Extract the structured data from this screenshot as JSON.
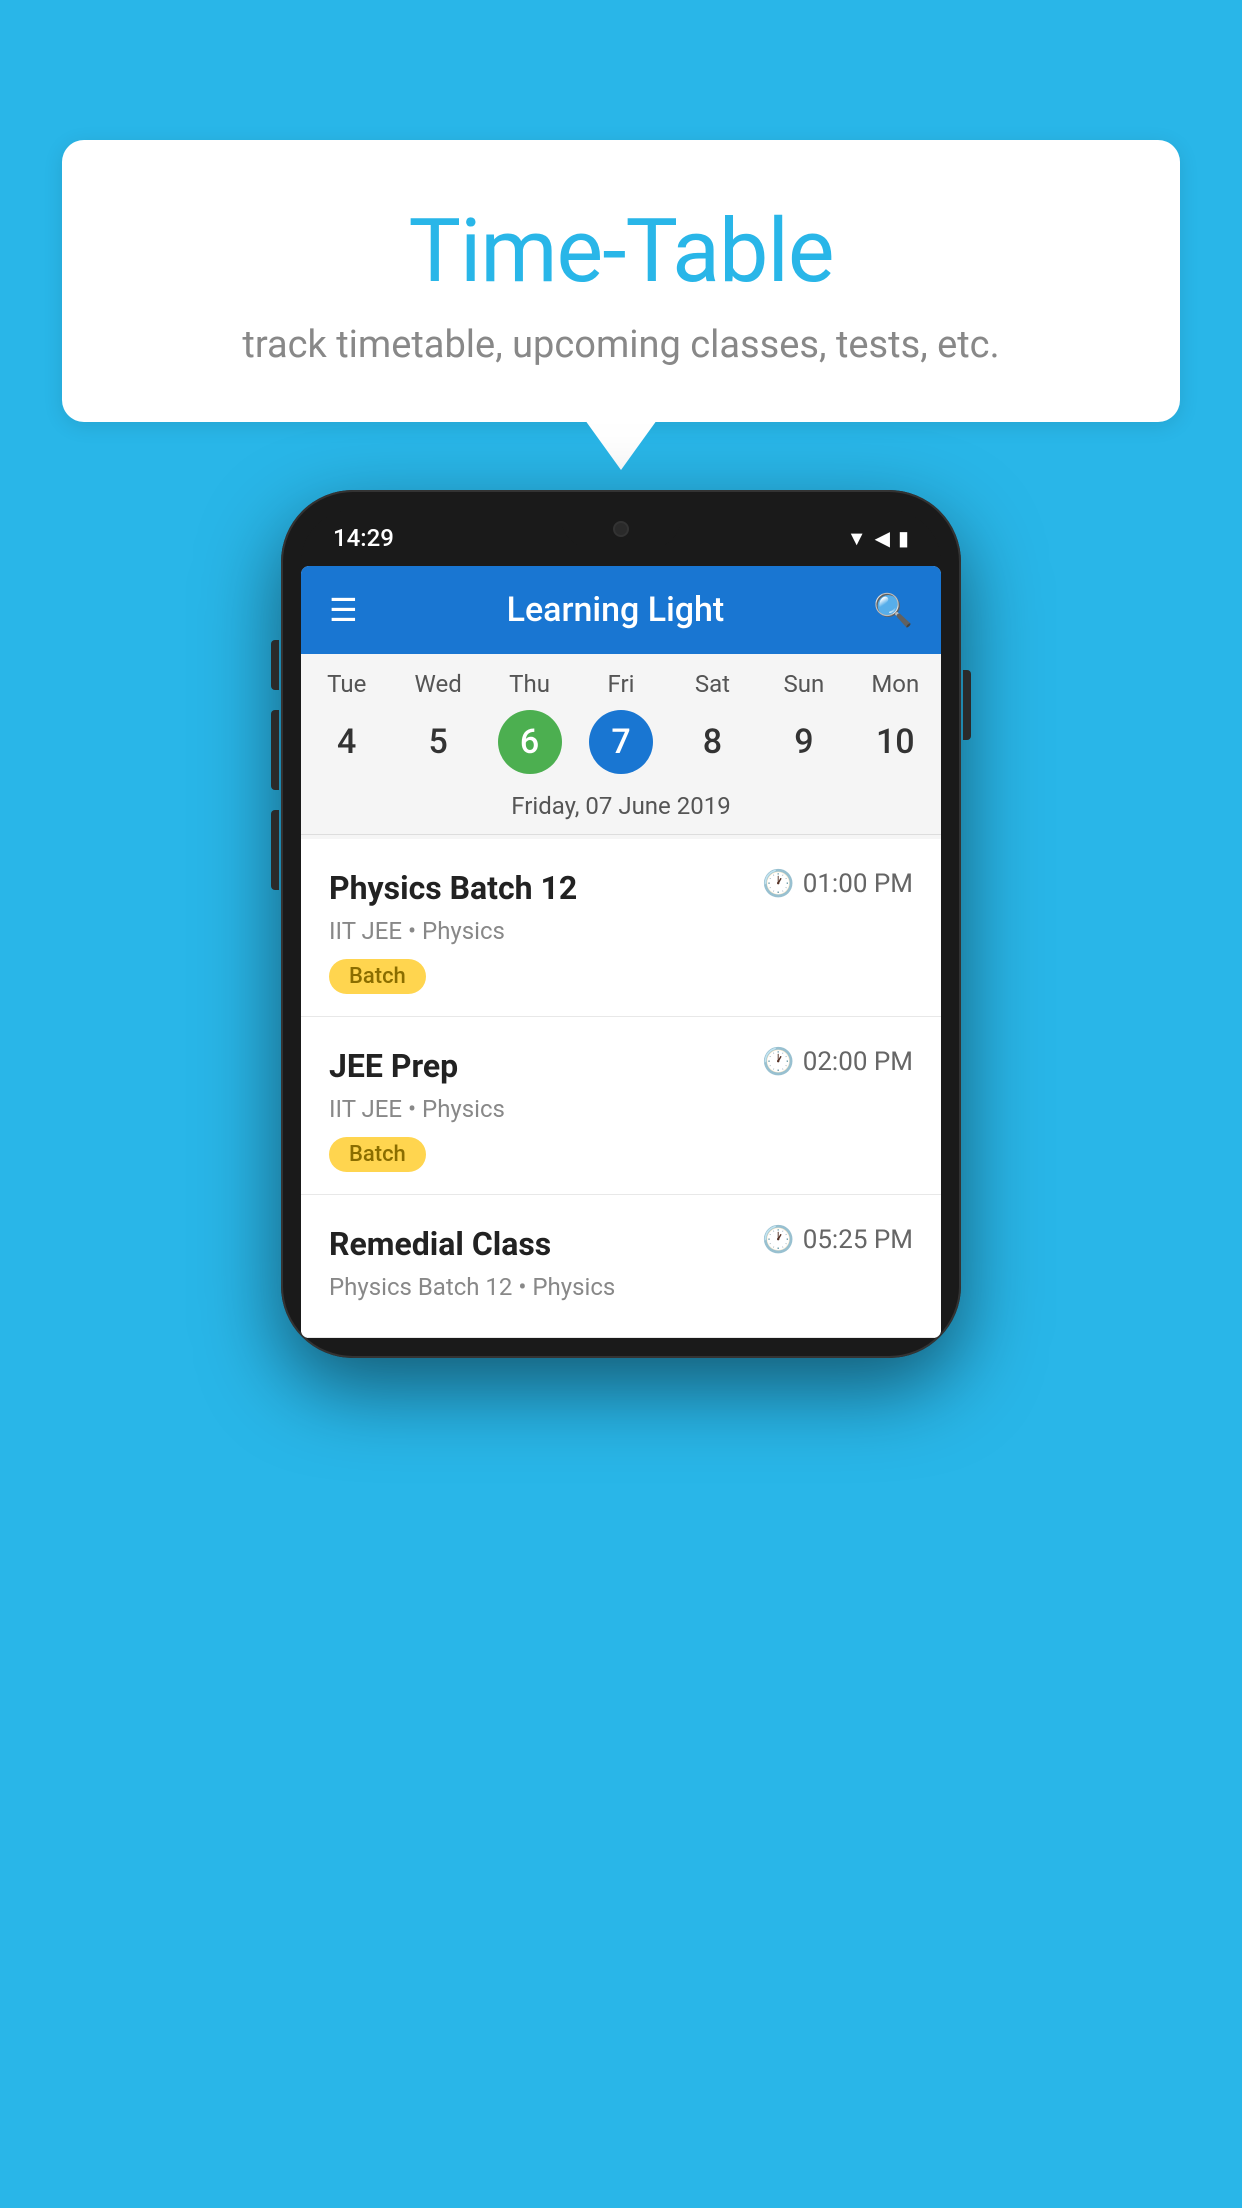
{
  "background_color": "#29b6e8",
  "bubble": {
    "title": "Time-Table",
    "subtitle": "track timetable, upcoming classes, tests, etc."
  },
  "phone": {
    "status_bar": {
      "time": "14:29"
    },
    "app_bar": {
      "title": "Learning Light"
    },
    "calendar": {
      "days": [
        "Tue",
        "Wed",
        "Thu",
        "Fri",
        "Sat",
        "Sun",
        "Mon"
      ],
      "dates": [
        "4",
        "5",
        "6",
        "7",
        "8",
        "9",
        "10"
      ],
      "today_index": 2,
      "selected_index": 3,
      "selected_label": "Friday, 07 June 2019"
    },
    "events": [
      {
        "title": "Physics Batch 12",
        "time": "01:00 PM",
        "subtitle": "IIT JEE • Physics",
        "badge": "Batch"
      },
      {
        "title": "JEE Prep",
        "time": "02:00 PM",
        "subtitle": "IIT JEE • Physics",
        "badge": "Batch"
      },
      {
        "title": "Remedial Class",
        "time": "05:25 PM",
        "subtitle": "Physics Batch 12 • Physics",
        "badge": ""
      }
    ]
  }
}
